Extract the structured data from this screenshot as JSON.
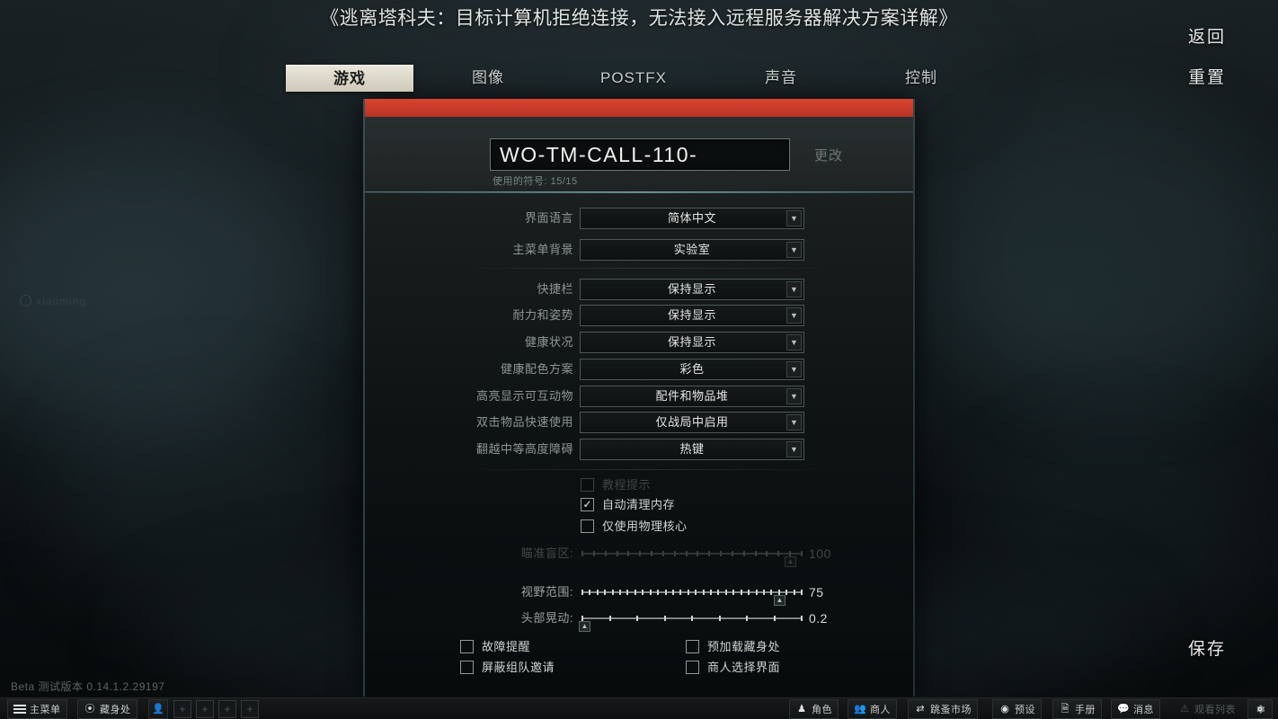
{
  "title_overlay": "《逃离塔科夫：目标计算机拒绝连接，无法接入远程服务器解决方案详解》",
  "side_buttons": {
    "back": "返回",
    "reset": "重置",
    "save": "保存"
  },
  "tabs": [
    {
      "label": "游戏",
      "active": true,
      "name": "tab-game"
    },
    {
      "label": "图像",
      "active": false,
      "name": "tab-graphics"
    },
    {
      "label": "POSTFX",
      "active": false,
      "name": "tab-postfx"
    },
    {
      "label": "声音",
      "active": false,
      "name": "tab-sound"
    },
    {
      "label": "控制",
      "active": false,
      "name": "tab-controls"
    }
  ],
  "nickname": {
    "value": "WO-TM-CALL-110-",
    "placeholder": "WO-TM-CALL-110-",
    "symbols_used_label": "使用的符号: 15/15",
    "change_label": "更改"
  },
  "settings_group_1": [
    {
      "label": "界面语言",
      "value": "简体中文",
      "name": "interface-language"
    },
    {
      "label": "主菜单背景",
      "value": "实验室",
      "name": "main-menu-background"
    }
  ],
  "settings_group_2": [
    {
      "label": "快捷栏",
      "value": "保持显示",
      "name": "quick-slots"
    },
    {
      "label": "耐力和姿势",
      "value": "保持显示",
      "name": "stamina-and-stance"
    },
    {
      "label": "健康状况",
      "value": "保持显示",
      "name": "health-status"
    },
    {
      "label": "健康配色方案",
      "value": "彩色",
      "name": "health-color-scheme"
    },
    {
      "label": "高亮显示可互动物",
      "value": "配件和物品堆",
      "name": "highlight-interactables"
    },
    {
      "label": "双击物品快速使用",
      "value": "仅战局中启用",
      "name": "double-click-quick-use"
    },
    {
      "label": "翻越中等高度障碍",
      "value": "热键",
      "name": "vault-medium-obstacles"
    }
  ],
  "checkboxes_mid": [
    {
      "label": "教程提示",
      "checked": false,
      "disabled": true,
      "name": "tutorial-hints"
    },
    {
      "label": "自动清理内存",
      "checked": true,
      "disabled": false,
      "name": "auto-clear-memory"
    },
    {
      "label": "仅使用物理核心",
      "checked": false,
      "disabled": false,
      "name": "physical-cores-only"
    }
  ],
  "sliders": [
    {
      "label": "瞄准盲区:",
      "value": "100",
      "pos": 93,
      "disabled": true,
      "ticks": 20,
      "name": "aim-deadzone"
    },
    {
      "label": "视野范围:",
      "value": "75",
      "pos": 88,
      "disabled": false,
      "ticks": 30,
      "name": "field-of-view"
    },
    {
      "label": "头部晃动:",
      "value": "0.2",
      "pos": 2,
      "disabled": false,
      "ticks": 9,
      "name": "head-bobbing"
    }
  ],
  "checkboxes_bottom_left": [
    {
      "label": "故障提醒",
      "checked": false,
      "name": "malfunction-alert"
    },
    {
      "label": "屏蔽组队邀请",
      "checked": false,
      "name": "block-group-invites"
    }
  ],
  "checkboxes_bottom_right": [
    {
      "label": "预加载藏身处",
      "checked": false,
      "name": "preload-hideout"
    },
    {
      "label": "商人选择界面",
      "checked": false,
      "name": "trader-selection-screen"
    }
  ],
  "version": "Beta 测试版本 0.14.1.2.29197",
  "watermark": "xiaoming",
  "taskbar_left": [
    {
      "label": "主菜单",
      "icon": "hamburger-icon",
      "name": "taskbar-main-menu"
    },
    {
      "label": "藏身处",
      "icon": "hideout-icon",
      "name": "taskbar-hideout"
    }
  ],
  "taskbar_slots": [
    "+",
    "+",
    "+",
    "+"
  ],
  "taskbar_right": [
    {
      "label": "角色",
      "icon": "character-icon",
      "dim": false,
      "name": "taskbar-character"
    },
    {
      "label": "商人",
      "icon": "traders-icon",
      "dim": false,
      "name": "taskbar-traders"
    },
    {
      "label": "跳蚤市场",
      "icon": "flea-market-icon",
      "dim": false,
      "name": "taskbar-flea-market"
    },
    {
      "label": "预设",
      "icon": "presets-icon",
      "dim": false,
      "name": "taskbar-presets"
    },
    {
      "label": "手册",
      "icon": "handbook-icon",
      "dim": false,
      "name": "taskbar-handbook"
    },
    {
      "label": "消息",
      "icon": "messenger-icon",
      "dim": false,
      "name": "taskbar-messenger"
    },
    {
      "label": "观看列表",
      "icon": "watchlist-icon",
      "dim": true,
      "name": "taskbar-watchlist"
    }
  ],
  "colors": {
    "accent_red": "#c8392a",
    "panel_border_teal": "#78afb9",
    "tab_active_bg": "#ddd9cb"
  }
}
